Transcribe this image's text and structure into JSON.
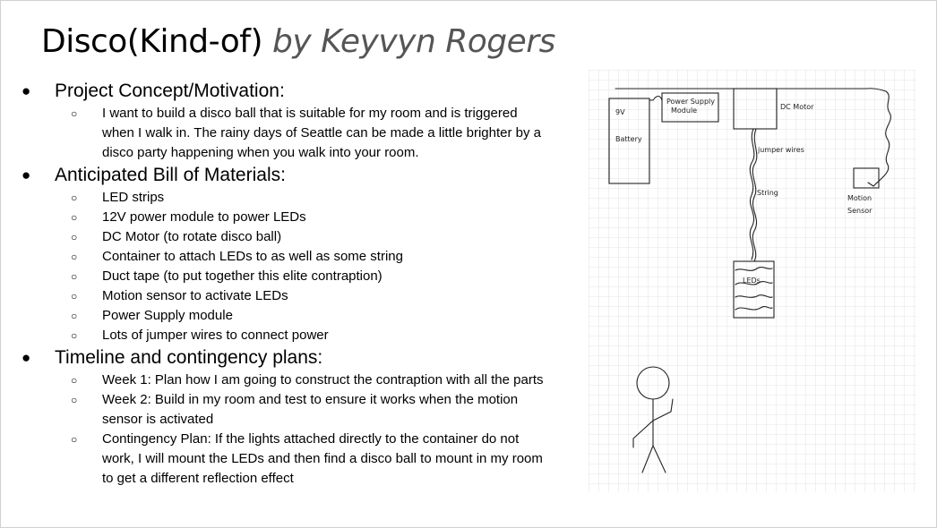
{
  "title": {
    "main": "Disco(Kind-of)",
    "byline": "by Keyvyn Rogers"
  },
  "bullets": {
    "primary": "●",
    "secondary": "○"
  },
  "sections": {
    "concept": {
      "heading": "Project Concept/Motivation:",
      "items": [
        "I want to build a disco ball that is suitable for my room and is triggered when I walk in. The rainy days of Seattle can be made a little brighter by a disco party happening when you walk into your room."
      ]
    },
    "materials": {
      "heading": "Anticipated Bill of Materials:",
      "items": [
        "LED strips",
        "12V power module to power LEDs",
        "DC Motor (to rotate disco ball)",
        "Container to attach LEDs to as well as some string",
        "Duct tape (to put together this elite contraption)",
        "Motion sensor to activate LEDs",
        "Power Supply module",
        "Lots of jumper wires to connect power"
      ]
    },
    "timeline": {
      "heading": "Timeline and contingency plans:",
      "items": [
        "Week 1: Plan how I am going to construct the contraption with all the parts",
        "Week 2: Build in my room and test to ensure it works when the motion sensor is activated",
        "Contingency Plan: If the lights attached directly to the container do not work, I will mount the LEDs and then find a disco ball to mount in my room to get a different reflection effect"
      ]
    }
  },
  "sketch": {
    "labels": {
      "battery_top": "9V",
      "battery_bottom": "Battery",
      "power_line1": "Power Supply",
      "power_line2": "Module",
      "motor": "DC Motor",
      "jumper": "jumper wires",
      "string": "String",
      "sensor_line1": "Motion",
      "sensor_line2": "Sensor",
      "leds": "LEDs"
    }
  }
}
